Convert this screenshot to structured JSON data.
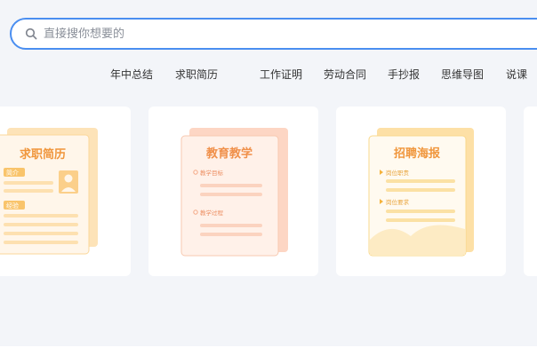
{
  "search": {
    "placeholder": "直接搜你想要的"
  },
  "categories": [
    "年中总结",
    "求职简历",
    "工作证明",
    "劳动合同",
    "手抄报",
    "思维导图",
    "说课"
  ],
  "cards": {
    "resume": {
      "title": "求职简历",
      "tag_intro": "简介",
      "tag_experience": "经验"
    },
    "education": {
      "title": "教育教学",
      "goal": "教学目标",
      "process": "教学过程"
    },
    "recruit": {
      "title": "招聘海报",
      "duty": "岗位职责",
      "requirement": "岗位要求"
    }
  },
  "colors": {
    "accent_blue": "#4a8ef0",
    "orange_text": "#f0963c",
    "page_bg": "#f3f5f9"
  }
}
